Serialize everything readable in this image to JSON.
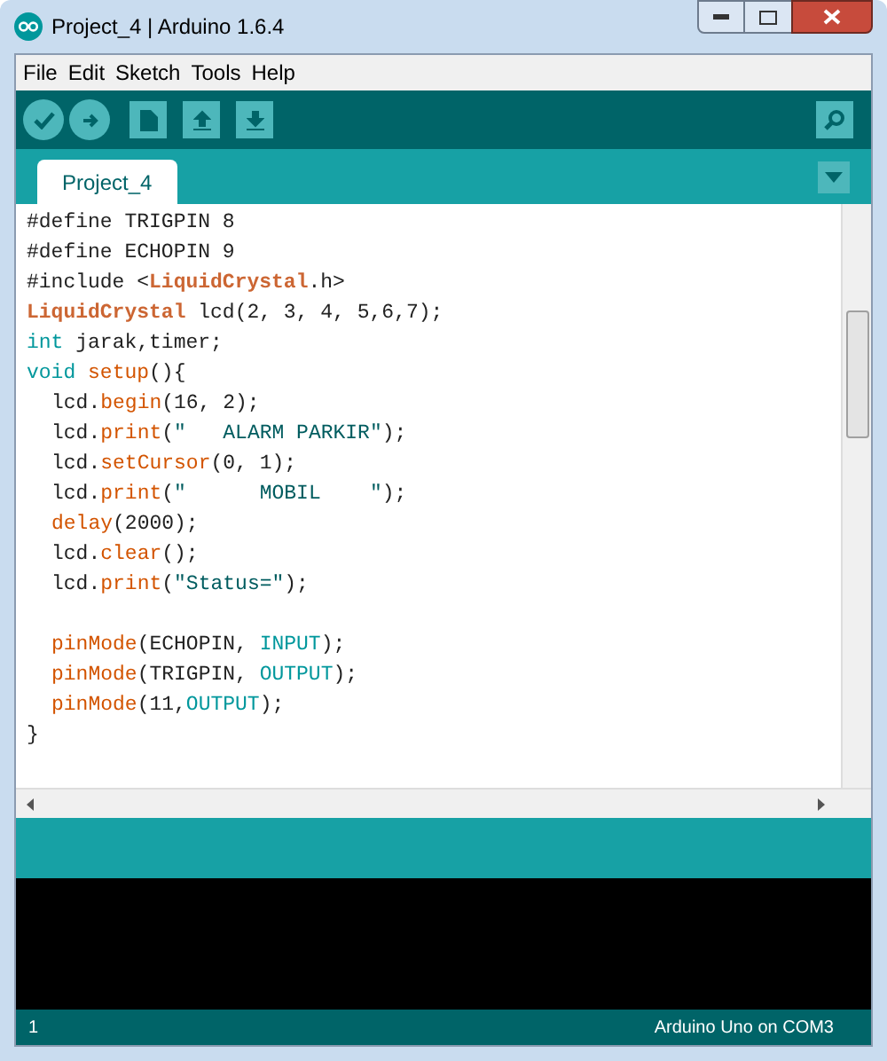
{
  "window": {
    "title": "Project_4 | Arduino 1.6.4"
  },
  "menu": [
    "File",
    "Edit",
    "Sketch",
    "Tools",
    "Help"
  ],
  "tabs": [
    {
      "label": "Project_4",
      "selected": true
    }
  ],
  "code": [
    {
      "kind": "code",
      "tokens": [
        {
          "kind": "plain",
          "text": "#define TRIGPIN 8"
        }
      ]
    },
    {
      "kind": "code",
      "tokens": [
        {
          "kind": "plain",
          "text": "#define ECHOPIN 9"
        }
      ]
    },
    {
      "kind": "code",
      "tokens": [
        {
          "kind": "plain",
          "text": "#include <"
        },
        {
          "kind": "class",
          "text": "LiquidCrystal"
        },
        {
          "kind": "plain",
          "text": ".h>"
        }
      ]
    },
    {
      "kind": "code",
      "tokens": [
        {
          "kind": "class",
          "text": "LiquidCrystal"
        },
        {
          "kind": "plain",
          "text": " lcd(2, 3, 4, 5,6,7);"
        }
      ]
    },
    {
      "kind": "code",
      "tokens": [
        {
          "kind": "type",
          "text": "int"
        },
        {
          "kind": "plain",
          "text": " jarak,timer;"
        }
      ]
    },
    {
      "kind": "code",
      "tokens": [
        {
          "kind": "type",
          "text": "void "
        },
        {
          "kind": "func",
          "text": "setup"
        },
        {
          "kind": "plain",
          "text": "(){"
        }
      ],
      "children": [
        {
          "kind": "code",
          "tokens": [
            {
              "kind": "plain",
              "text": "lcd."
            },
            {
              "kind": "func",
              "text": "begin"
            },
            {
              "kind": "plain",
              "text": "(16, 2);"
            }
          ]
        },
        {
          "kind": "code",
          "tokens": [
            {
              "kind": "plain",
              "text": "lcd."
            },
            {
              "kind": "func",
              "text": "print"
            },
            {
              "kind": "plain",
              "text": "("
            },
            {
              "kind": "string",
              "text": "\"   ALARM PARKIR\""
            },
            {
              "kind": "plain",
              "text": ");"
            }
          ]
        },
        {
          "kind": "code",
          "tokens": [
            {
              "kind": "plain",
              "text": "lcd."
            },
            {
              "kind": "func",
              "text": "setCursor"
            },
            {
              "kind": "plain",
              "text": "(0, 1);"
            }
          ]
        },
        {
          "kind": "code",
          "tokens": [
            {
              "kind": "plain",
              "text": "lcd."
            },
            {
              "kind": "func",
              "text": "print"
            },
            {
              "kind": "plain",
              "text": "("
            },
            {
              "kind": "string",
              "text": "\"      MOBIL    \""
            },
            {
              "kind": "plain",
              "text": ");"
            }
          ]
        },
        {
          "kind": "code",
          "tokens": [
            {
              "kind": "func",
              "text": "delay"
            },
            {
              "kind": "plain",
              "text": "(2000);"
            }
          ]
        },
        {
          "kind": "code",
          "tokens": [
            {
              "kind": "plain",
              "text": "lcd."
            },
            {
              "kind": "func",
              "text": "clear"
            },
            {
              "kind": "plain",
              "text": "();"
            }
          ]
        },
        {
          "kind": "code",
          "tokens": [
            {
              "kind": "plain",
              "text": "lcd."
            },
            {
              "kind": "func",
              "text": "print"
            },
            {
              "kind": "plain",
              "text": "("
            },
            {
              "kind": "string",
              "text": "\"Status=\""
            },
            {
              "kind": "plain",
              "text": ");"
            }
          ]
        },
        {
          "kind": "blank"
        },
        {
          "kind": "code",
          "tokens": [
            {
              "kind": "func",
              "text": "pinMode"
            },
            {
              "kind": "plain",
              "text": "(ECHOPIN, "
            },
            {
              "kind": "type",
              "text": "INPUT"
            },
            {
              "kind": "plain",
              "text": ");"
            }
          ]
        },
        {
          "kind": "code",
          "tokens": [
            {
              "kind": "func",
              "text": "pinMode"
            },
            {
              "kind": "plain",
              "text": "(TRIGPIN, "
            },
            {
              "kind": "type",
              "text": "OUTPUT"
            },
            {
              "kind": "plain",
              "text": ");"
            }
          ]
        },
        {
          "kind": "code",
          "tokens": [
            {
              "kind": "func",
              "text": "pinMode"
            },
            {
              "kind": "plain",
              "text": "(11,"
            },
            {
              "kind": "type",
              "text": "OUTPUT"
            },
            {
              "kind": "plain",
              "text": ");"
            }
          ]
        }
      ]
    },
    {
      "kind": "code",
      "tokens": [
        {
          "kind": "plain",
          "text": "}"
        }
      ]
    }
  ],
  "status_bar": {
    "line": "1",
    "board": "Arduino Uno on COM3"
  }
}
